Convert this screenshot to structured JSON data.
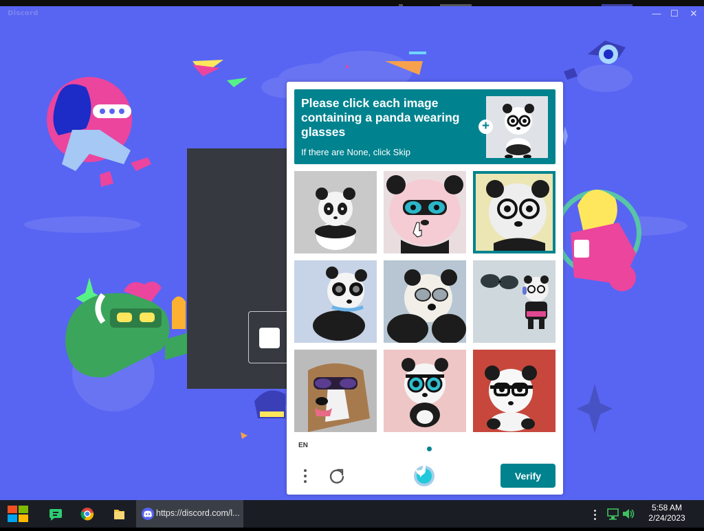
{
  "app": {
    "title": "Discord",
    "window_controls": {
      "minimize": "—",
      "maximize": "☐",
      "close": "✕"
    }
  },
  "captcha": {
    "prompt": "Please click each image containing a panda wearing glasses",
    "subprompt": "If there are None, click Skip",
    "example_icon": "panda-with-glasses",
    "tiles": [
      {
        "subject": "panda plush, no glasses",
        "selected": false
      },
      {
        "subject": "panda with blue goggles",
        "selected": false
      },
      {
        "subject": "panda with black glasses",
        "selected": true
      },
      {
        "subject": "panda with black glasses",
        "selected": false
      },
      {
        "subject": "panda with glasses",
        "selected": false
      },
      {
        "subject": "panda with floating sunglasses",
        "selected": false
      },
      {
        "subject": "dog with sunglasses",
        "selected": false
      },
      {
        "subject": "panda with black glasses",
        "selected": false
      },
      {
        "subject": "panda with black glasses",
        "selected": false
      }
    ],
    "language": "EN",
    "verify_label": "Verify",
    "accent_color": "#00838f"
  },
  "taskbar": {
    "discord_tab": "https://discord.com/l...",
    "time": "5:58 AM",
    "date": "2/24/2023"
  },
  "colors": {
    "discord_bg": "#5865F2",
    "login_card": "#36393f",
    "taskbar": "#1a1d24"
  }
}
